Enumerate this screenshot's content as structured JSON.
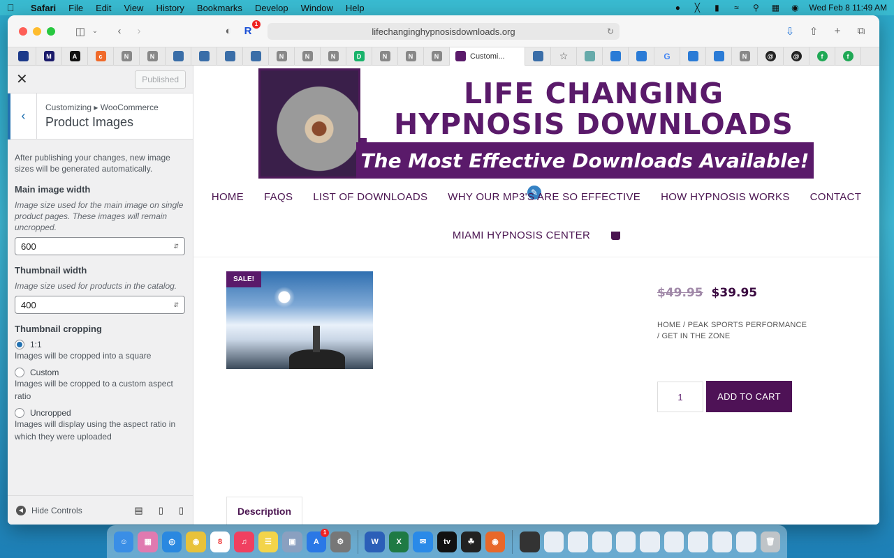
{
  "menubar": {
    "app": "Safari",
    "items": [
      "File",
      "Edit",
      "View",
      "History",
      "Bookmarks",
      "Develop",
      "Window",
      "Help"
    ],
    "clock": "Wed Feb 8  11:49 AM"
  },
  "browser": {
    "url": "lifechanginghypnosisdownloads.org",
    "active_tab_title": "Customi...",
    "notification_count": "1"
  },
  "customizer": {
    "published_label": "Published",
    "breadcrumb": "Customizing ▸ WooCommerce",
    "section_title": "Product Images",
    "intro": "After publishing your changes, new image sizes will be generated automatically.",
    "main_width": {
      "label": "Main image width",
      "description": "Image size used for the main image on single product pages. These images will remain uncropped.",
      "value": "600"
    },
    "thumb_width": {
      "label": "Thumbnail width",
      "description": "Image size used for products in the catalog.",
      "value": "400"
    },
    "cropping": {
      "label": "Thumbnail cropping",
      "options": [
        {
          "label": "1:1",
          "description": "Images will be cropped into a square",
          "selected": true
        },
        {
          "label": "Custom",
          "description": "Images will be cropped to a custom aspect ratio",
          "selected": false
        },
        {
          "label": "Uncropped",
          "description": "Images will display using the aspect ratio in which they were uploaded",
          "selected": false
        }
      ]
    },
    "hide_controls": "Hide Controls"
  },
  "site": {
    "banner_title_line1": "LIFE CHANGING",
    "banner_title_line2": "HYPNOSIS DOWNLOADS",
    "banner_tagline": "The Most Effective Downloads Available!",
    "nav": [
      "HOME",
      "FAQS",
      "LIST OF DOWNLOADS",
      "WHY OUR MP3'S ARE SO EFFECTIVE",
      "HOW HYPNOSIS WORKS",
      "CONTACT"
    ],
    "nav_row2": "MIAMI HYPNOSIS CENTER",
    "sale_badge": "SALE!",
    "old_price": "$49.95",
    "new_price": "$39.95",
    "categories": "HOME / PEAK SPORTS PERFORMANCE / GET IN THE ZONE",
    "quantity": "1",
    "add_to_cart": "ADD TO CART",
    "description_tab": "Description"
  },
  "colors": {
    "brand_purple": "#5a1a6a",
    "wp_blue": "#2271b1"
  }
}
